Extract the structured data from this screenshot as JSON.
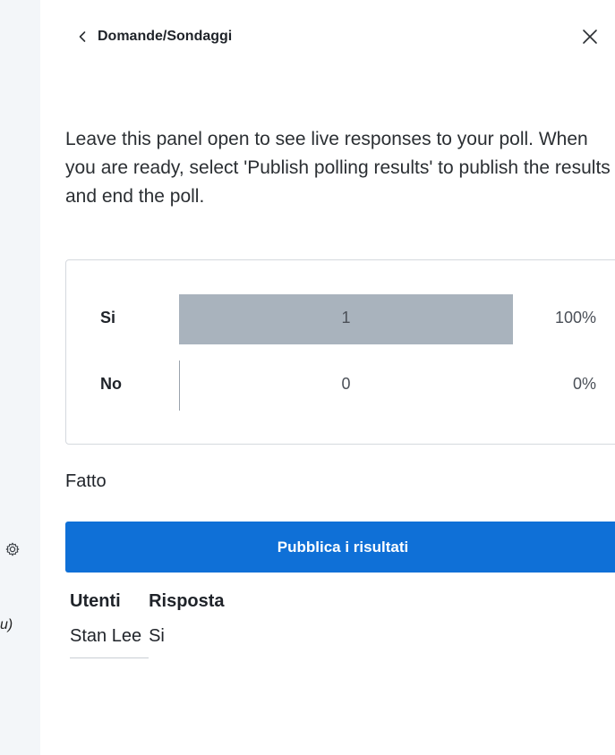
{
  "sidebar": {
    "gear_icon": "gear-icon",
    "partial_text": "u)"
  },
  "header": {
    "back_icon": "chevron-left-icon",
    "title": "Domande/Sondaggi",
    "close_icon": "close-icon"
  },
  "instructions": "Leave this panel open to see live responses to your poll. When you are ready, select 'Publish polling results' to publish the results and end the poll.",
  "results": [
    {
      "label": "Si",
      "count": "1",
      "percent": "100%",
      "fraction": 1.0
    },
    {
      "label": "No",
      "count": "0",
      "percent": "0%",
      "fraction": 0.0
    }
  ],
  "status": "Fatto",
  "publish_button": {
    "label": "Pubblica i risultati",
    "color": "#0f70d7"
  },
  "responses": {
    "headers": [
      "Utenti",
      "Risposta"
    ],
    "rows": [
      {
        "user": "Stan Lee",
        "answer": "Si"
      }
    ]
  }
}
